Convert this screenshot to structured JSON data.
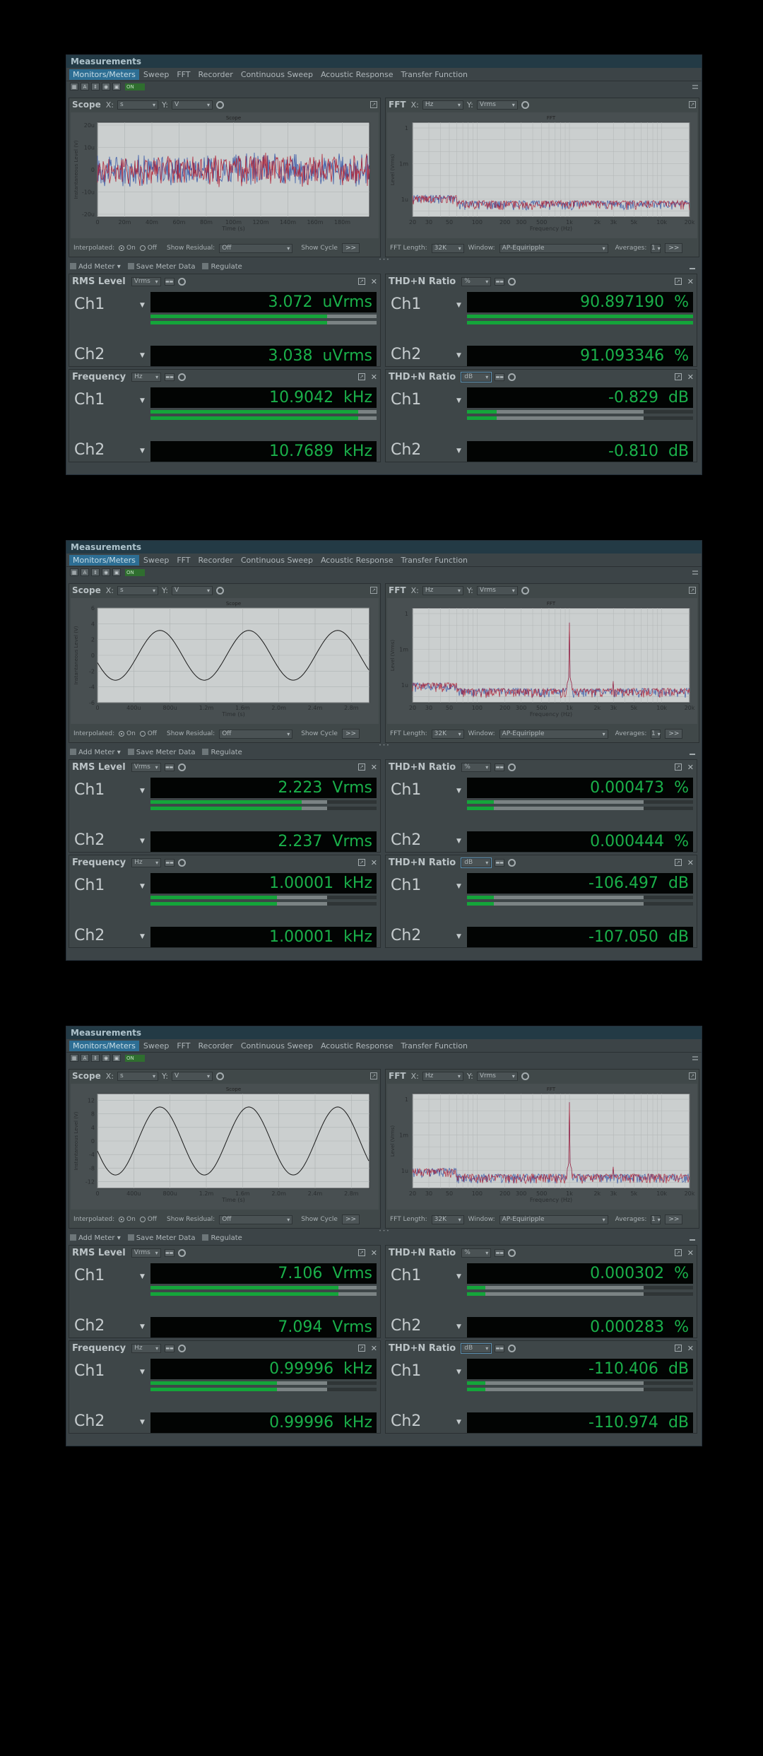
{
  "colors": {
    "page_bg": "#000000",
    "meter_text": "#1ab04a",
    "bar_fill": "#14a53a",
    "trace_red": "#b0283c",
    "trace_blue": "#3a5aa8"
  },
  "panels": [
    {
      "title": "Measurements",
      "menu": [
        "Monitors/Meters",
        "Sweep",
        "FFT",
        "Recorder",
        "Continuous Sweep",
        "Acoustic Response",
        "Transfer Function"
      ],
      "toggle": "ON",
      "scope": {
        "title": "Scope",
        "x_label": "X:",
        "x_unit": "s",
        "y_label": "Y:",
        "y_unit": "V",
        "footer": {
          "interpolated": "Interpolated:",
          "on": "On",
          "off": "Off",
          "show_residual": "Show Residual:",
          "residual_value": "Off",
          "show_cycle": "Show Cycle",
          "btn": ">>"
        },
        "chart_data": {
          "type": "line",
          "title": "Scope",
          "xlabel": "Time (s)",
          "ylabel": "Instantaneous Level (V)",
          "signal": "noise",
          "xticks": [
            "0",
            "20m",
            "40m",
            "60m",
            "80m",
            "100m",
            "120m",
            "140m",
            "160m",
            "180m"
          ],
          "xlim": [
            0,
            0.2
          ],
          "yticks": [
            "20u",
            "10u",
            "0",
            "-10u",
            "-20u"
          ],
          "ylim": [
            -20,
            20
          ],
          "series": [
            {
              "color": "#3a5aa8",
              "amplitude": 6
            },
            {
              "color": "#b0283c",
              "amplitude": 6
            }
          ]
        }
      },
      "fft": {
        "title": "FFT",
        "x_label": "X:",
        "x_unit": "Hz",
        "y_label": "Y:",
        "y_unit": "Vrms",
        "footer": {
          "length_label": "FFT Length:",
          "length": "32K",
          "window_label": "Window:",
          "window": "AP-Equiripple",
          "averages_label": "Averages:",
          "averages": "1",
          "btn": ">>"
        },
        "chart_data": {
          "type": "line",
          "title": "FFT",
          "xlabel": "Frequency (Hz)",
          "ylabel": "Level (Vrms)",
          "x_scale": "log",
          "y_scale": "log",
          "xticks": [
            "20",
            "30",
            "50",
            "100",
            "200",
            "300",
            "500",
            "1k",
            "2k",
            "3k",
            "5k",
            "10k",
            "20k"
          ],
          "yticks": [
            "1",
            "1m",
            "1u"
          ],
          "peak": null
        }
      },
      "meter_toolbar": {
        "add": "Add Meter",
        "save": "Save Meter Data",
        "regulate": "Regulate"
      },
      "meters": [
        {
          "title": "RMS Level",
          "unit": "Vrms",
          "ch1": {
            "label": "Ch1",
            "value": "3.072",
            "unit": "uVrms",
            "fill": 0.78
          },
          "ch2": {
            "label": "Ch2",
            "value": "3.038",
            "unit": "uVrms",
            "fill": 0.78
          }
        },
        {
          "title": "THD+N Ratio",
          "unit": "%",
          "ch1": {
            "label": "Ch1",
            "value": "90.897190",
            "unit": "%",
            "fill": 1.0
          },
          "ch2": {
            "label": "Ch2",
            "value": "91.093346",
            "unit": "%",
            "fill": 1.0
          }
        },
        {
          "title": "Frequency",
          "unit": "Hz",
          "ch1": {
            "label": "Ch1",
            "value": "10.9042",
            "unit": "kHz",
            "fill": 0.92
          },
          "ch2": {
            "label": "Ch2",
            "value": "10.7689",
            "unit": "kHz",
            "fill": 0.92
          }
        },
        {
          "title": "THD+N Ratio",
          "unit": "dB",
          "ch1": {
            "label": "Ch1",
            "value": "-0.829",
            "unit": "dB",
            "fill": 0.13
          },
          "ch2": {
            "label": "Ch2",
            "value": "-0.810",
            "unit": "dB",
            "fill": 0.13
          }
        }
      ]
    },
    {
      "title": "Measurements",
      "menu": [
        "Monitors/Meters",
        "Sweep",
        "FFT",
        "Recorder",
        "Continuous Sweep",
        "Acoustic Response",
        "Transfer Function"
      ],
      "toggle": "ON",
      "scope": {
        "title": "Scope",
        "x_label": "X:",
        "x_unit": "s",
        "y_label": "Y:",
        "y_unit": "V",
        "footer": {
          "interpolated": "Interpolated:",
          "on": "On",
          "off": "Off",
          "show_residual": "Show Residual:",
          "residual_value": "Off",
          "show_cycle": "Show Cycle",
          "btn": ">>"
        },
        "chart_data": {
          "type": "line",
          "title": "Scope",
          "xlabel": "Time (s)",
          "ylabel": "Instantaneous Level (V)",
          "signal": "sine",
          "xticks": [
            "0",
            "400u",
            "800u",
            "1.2m",
            "1.6m",
            "2.0m",
            "2.4m",
            "2.8m"
          ],
          "xlim": [
            0,
            3.0
          ],
          "yticks": [
            "6",
            "4",
            "2",
            "0",
            "-2",
            "-4",
            "-6"
          ],
          "ylim": [
            -6,
            6
          ],
          "series": [
            {
              "color": "#1a1a1a",
              "amplitude": 3.15,
              "cycles": 3
            }
          ]
        }
      },
      "fft": {
        "title": "FFT",
        "x_label": "X:",
        "x_unit": "Hz",
        "y_label": "Y:",
        "y_unit": "Vrms",
        "footer": {
          "length_label": "FFT Length:",
          "length": "32K",
          "window_label": "Window:",
          "window": "AP-Equiripple",
          "averages_label": "Averages:",
          "averages": "1",
          "btn": ">>"
        },
        "chart_data": {
          "type": "line",
          "title": "FFT",
          "xlabel": "Frequency (Hz)",
          "ylabel": "Level (Vrms)",
          "x_scale": "log",
          "y_scale": "log",
          "xticks": [
            "20",
            "30",
            "50",
            "100",
            "200",
            "300",
            "500",
            "1k",
            "2k",
            "3k",
            "5k",
            "10k",
            "20k"
          ],
          "yticks": [
            "1",
            "1m",
            "1u"
          ],
          "peak": {
            "freq": 1000,
            "level": 2.2
          }
        }
      },
      "meter_toolbar": {
        "add": "Add Meter",
        "save": "Save Meter Data",
        "regulate": "Regulate"
      },
      "meters": [
        {
          "title": "RMS Level",
          "unit": "Vrms",
          "ch1": {
            "label": "Ch1",
            "value": "2.223",
            "unit": "Vrms",
            "fill": 0.67
          },
          "ch2": {
            "label": "Ch2",
            "value": "2.237",
            "unit": "Vrms",
            "fill": 0.67
          }
        },
        {
          "title": "THD+N Ratio",
          "unit": "%",
          "ch1": {
            "label": "Ch1",
            "value": "0.000473",
            "unit": "%",
            "fill": 0.12
          },
          "ch2": {
            "label": "Ch2",
            "value": "0.000444",
            "unit": "%",
            "fill": 0.12
          }
        },
        {
          "title": "Frequency",
          "unit": "Hz",
          "ch1": {
            "label": "Ch1",
            "value": "1.00001",
            "unit": "kHz",
            "fill": 0.56
          },
          "ch2": {
            "label": "Ch2",
            "value": "1.00001",
            "unit": "kHz",
            "fill": 0.56
          }
        },
        {
          "title": "THD+N Ratio",
          "unit": "dB",
          "ch1": {
            "label": "Ch1",
            "value": "-106.497",
            "unit": "dB",
            "fill": 0.12
          },
          "ch2": {
            "label": "Ch2",
            "value": "-107.050",
            "unit": "dB",
            "fill": 0.12
          }
        }
      ]
    },
    {
      "title": "Measurements",
      "menu": [
        "Monitors/Meters",
        "Sweep",
        "FFT",
        "Recorder",
        "Continuous Sweep",
        "Acoustic Response",
        "Transfer Function"
      ],
      "toggle": "ON",
      "scope": {
        "title": "Scope",
        "x_label": "X:",
        "x_unit": "s",
        "y_label": "Y:",
        "y_unit": "V",
        "footer": {
          "interpolated": "Interpolated:",
          "on": "On",
          "off": "Off",
          "show_residual": "Show Residual:",
          "residual_value": "Off",
          "show_cycle": "Show Cycle",
          "btn": ">>"
        },
        "chart_data": {
          "type": "line",
          "title": "Scope",
          "xlabel": "Time (s)",
          "ylabel": "Instantaneous Level (V)",
          "signal": "sine",
          "xticks": [
            "0",
            "400u",
            "800u",
            "1.2m",
            "1.6m",
            "2.0m",
            "2.4m",
            "2.8m"
          ],
          "xlim": [
            0,
            3.0
          ],
          "yticks": [
            "12",
            "8",
            "4",
            "0",
            "-4",
            "-8",
            "-12"
          ],
          "ylim": [
            -14,
            14
          ],
          "series": [
            {
              "color": "#1a1a1a",
              "amplitude": 10.05,
              "cycles": 3
            }
          ]
        }
      },
      "fft": {
        "title": "FFT",
        "x_label": "X:",
        "x_unit": "Hz",
        "y_label": "Y:",
        "y_unit": "Vrms",
        "footer": {
          "length_label": "FFT Length:",
          "length": "32K",
          "window_label": "Window:",
          "window": "AP-Equiripple",
          "averages_label": "Averages:",
          "averages": "1",
          "btn": ">>"
        },
        "chart_data": {
          "type": "line",
          "title": "FFT",
          "xlabel": "Frequency (Hz)",
          "ylabel": "Level (Vrms)",
          "x_scale": "log",
          "y_scale": "log",
          "xticks": [
            "20",
            "30",
            "50",
            "100",
            "200",
            "300",
            "500",
            "1k",
            "2k",
            "3k",
            "5k",
            "10k",
            "20k"
          ],
          "yticks": [
            "1",
            "1m",
            "1u"
          ],
          "peak": {
            "freq": 1000,
            "level": 7.1
          }
        }
      },
      "meter_toolbar": {
        "add": "Add Meter",
        "save": "Save Meter Data",
        "regulate": "Regulate"
      },
      "meters": [
        {
          "title": "RMS Level",
          "unit": "Vrms",
          "ch1": {
            "label": "Ch1",
            "value": "7.106",
            "unit": "Vrms",
            "fill": 0.83
          },
          "ch2": {
            "label": "Ch2",
            "value": "7.094",
            "unit": "Vrms",
            "fill": 0.83
          }
        },
        {
          "title": "THD+N Ratio",
          "unit": "%",
          "ch1": {
            "label": "Ch1",
            "value": "0.000302",
            "unit": "%",
            "fill": 0.08
          },
          "ch2": {
            "label": "Ch2",
            "value": "0.000283",
            "unit": "%",
            "fill": 0.08
          }
        },
        {
          "title": "Frequency",
          "unit": "Hz",
          "ch1": {
            "label": "Ch1",
            "value": "0.99996",
            "unit": "kHz",
            "fill": 0.56
          },
          "ch2": {
            "label": "Ch2",
            "value": "0.99996",
            "unit": "kHz",
            "fill": 0.56
          }
        },
        {
          "title": "THD+N Ratio",
          "unit": "dB",
          "ch1": {
            "label": "Ch1",
            "value": "-110.406",
            "unit": "dB",
            "fill": 0.08
          },
          "ch2": {
            "label": "Ch2",
            "value": "-110.974",
            "unit": "dB",
            "fill": 0.08
          }
        }
      ]
    }
  ]
}
